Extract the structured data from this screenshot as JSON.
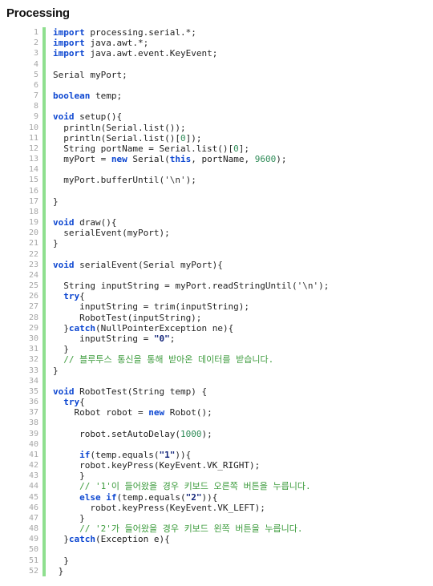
{
  "page": {
    "title": "Processing",
    "language": "Processing / Java",
    "total_lines": 52,
    "colors": {
      "background": "#ffffff",
      "gutter_text": "#a6a6a6",
      "gutter_accent_bar": "#8fdf8f",
      "keyword": "#0d47d1",
      "number": "#2e8b57",
      "string": "#13257a",
      "comment": "#3c9b3c",
      "plain_text": "#222222",
      "title_text": "#111111"
    }
  },
  "code": {
    "line_numbers": [
      1,
      2,
      3,
      4,
      5,
      6,
      7,
      8,
      9,
      10,
      11,
      12,
      13,
      14,
      15,
      16,
      17,
      18,
      19,
      20,
      21,
      22,
      23,
      24,
      25,
      26,
      27,
      28,
      29,
      30,
      31,
      32,
      33,
      34,
      35,
      36,
      37,
      38,
      39,
      40,
      41,
      42,
      43,
      44,
      45,
      46,
      47,
      48,
      49,
      50,
      51,
      52
    ],
    "lines": [
      "import processing.serial.*;",
      "import java.awt.*;",
      "import java.awt.event.KeyEvent;",
      "",
      "Serial myPort;",
      "",
      "boolean temp;",
      "",
      "void setup(){",
      "  println(Serial.list());",
      "  println(Serial.list()[0]);",
      "  String portName = Serial.list()[0];",
      "  myPort = new Serial(this, portName, 9600);",
      "",
      "  myPort.bufferUntil('\\n');",
      "",
      "}",
      "",
      "void draw(){",
      "  serialEvent(myPort);",
      "}",
      "",
      "void serialEvent(Serial myPort){",
      "",
      "  String inputString = myPort.readStringUntil('\\n');",
      "  try{",
      "     inputString = trim(inputString);",
      "     RobotTest(inputString);",
      "  }catch(NullPointerException ne){",
      "     inputString = \"0\";",
      "  }",
      "  // 블루투스 통신을 통해 받아온 데이터를 받습니다.",
      "}",
      "",
      "void RobotTest(String temp) {",
      "  try{",
      "    Robot robot = new Robot();",
      "",
      "     robot.setAutoDelay(1000);",
      "",
      "     if(temp.equals(\"1\")){",
      "     robot.keyPress(KeyEvent.VK_RIGHT);",
      "     }",
      "     // '1'이 들어왔을 경우 키보드 오른쪽 버튼을 누릅니다.",
      "     else if(temp.equals(\"2\")){",
      "       robot.keyPress(KeyEvent.VK_LEFT);",
      "     }",
      "     // '2'가 들어왔을 경우 키보드 왼쪽 버튼을 누릅니다.",
      "  }catch(Exception e){",
      "",
      "  }",
      " }"
    ],
    "html_lines": [
      "<span class=\"tok-kw\">import</span> processing.serial.*;",
      "<span class=\"tok-kw\">import</span> java.awt.*;",
      "<span class=\"tok-kw\">import</span> java.awt.event.KeyEvent;",
      "",
      "Serial myPort;",
      "",
      "<span class=\"tok-kw\">boolean</span> temp;",
      "",
      "<span class=\"tok-kw\">void</span> setup(){",
      "  println(Serial.list());",
      "  println(Serial.list()[<span class=\"tok-num\">0</span>]);",
      "  String portName = Serial.list()[<span class=\"tok-num\">0</span>];",
      "  myPort = <span class=\"tok-kw\">new</span> Serial(<span class=\"tok-kw\">this</span>, portName, <span class=\"tok-num\">9600</span>);",
      "",
      "  myPort.bufferUntil(<span class=\"tok-chr\">'\\n'</span>);",
      "",
      "}",
      "",
      "<span class=\"tok-kw\">void</span> draw(){",
      "  serialEvent(myPort);",
      "}",
      "",
      "<span class=\"tok-kw\">void</span> serialEvent(Serial myPort){",
      "",
      "  String inputString = myPort.readStringUntil(<span class=\"tok-chr\">'\\n'</span>);",
      "  <span class=\"tok-kw\">try</span>{",
      "     inputString = trim(inputString);",
      "     RobotTest(inputString);",
      "  }<span class=\"tok-kw\">catch</span>(NullPointerException ne){",
      "     inputString = <span class=\"tok-str\">\"0\"</span>;",
      "  }",
      "  <span class=\"tok-cmt\">// 블루투스 통신을 통해 받아온 데이터를 받습니다.</span>",
      "}",
      "",
      "<span class=\"tok-kw\">void</span> RobotTest(String temp) {",
      "  <span class=\"tok-kw\">try</span>{",
      "    Robot robot = <span class=\"tok-kw\">new</span> Robot();",
      "",
      "     robot.setAutoDelay(<span class=\"tok-num\">1000</span>);",
      "",
      "     <span class=\"tok-kw\">if</span>(temp.equals(<span class=\"tok-str\">\"1\"</span>)){",
      "     robot.keyPress(KeyEvent.VK_RIGHT);",
      "     }",
      "     <span class=\"tok-cmt\">// '1'이 들어왔을 경우 키보드 오른쪽 버튼을 누릅니다.</span>",
      "     <span class=\"tok-kw\">else if</span>(temp.equals(<span class=\"tok-str\">\"2\"</span>)){",
      "       robot.keyPress(KeyEvent.VK_LEFT);",
      "     }",
      "     <span class=\"tok-cmt\">// '2'가 들어왔을 경우 키보드 왼쪽 버튼을 누릅니다.</span>",
      "  }<span class=\"tok-kw\">catch</span>(Exception e){",
      "",
      "  }",
      " }"
    ]
  }
}
